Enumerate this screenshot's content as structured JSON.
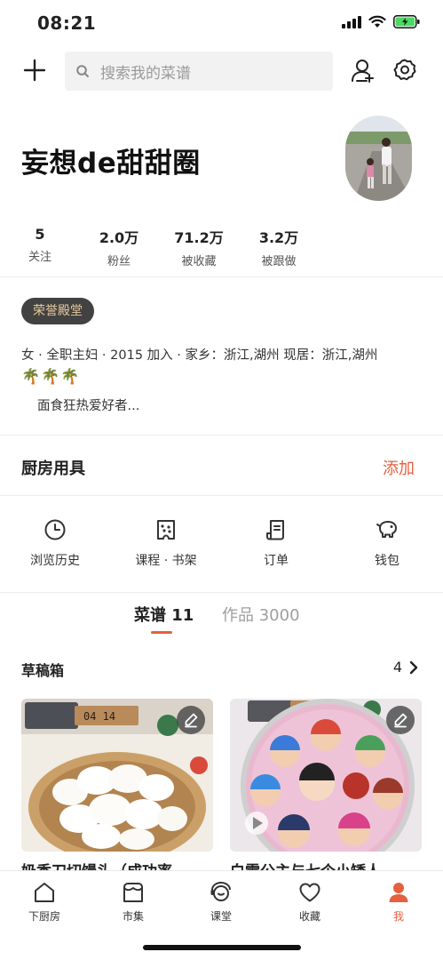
{
  "status_bar": {
    "time": "08:21"
  },
  "search": {
    "placeholder": "搜索我的菜谱"
  },
  "profile": {
    "name": "妄想de甜甜圈",
    "stats": [
      {
        "value": "5",
        "label": "关注"
      },
      {
        "value": "2.0万",
        "label": "粉丝"
      },
      {
        "value": "71.2万",
        "label": "被收藏"
      },
      {
        "value": "3.2万",
        "label": "被跟做"
      }
    ],
    "badge": "荣誉殿堂",
    "info": "女 · 全职主妇 · 2015 加入 · 家乡：浙江,湖州  现居：浙江,湖州",
    "palms": "🌴🌴🌴",
    "bio": "面食狂热爱好者..."
  },
  "kitchen": {
    "title": "厨房用具",
    "add_label": "添加"
  },
  "shortcuts": [
    {
      "label": "浏览历史",
      "icon": "clock-icon"
    },
    {
      "label": "课程 · 书架",
      "icon": "course-icon"
    },
    {
      "label": "订单",
      "icon": "receipt-icon"
    },
    {
      "label": "钱包",
      "icon": "piggy-bank-icon"
    }
  ],
  "tabs": [
    {
      "label": "菜谱 11",
      "active": true
    },
    {
      "label": "作品 3000",
      "active": false
    }
  ],
  "drafts": {
    "title": "草稿箱",
    "count": "4"
  },
  "cards": [
    {
      "title": "奶香刀切馒头（成功率"
    },
    {
      "title": "白雪公主与七个小矮人"
    }
  ],
  "tabbar": [
    {
      "label": "下厨房",
      "icon": "home-icon",
      "active": false
    },
    {
      "label": "市集",
      "icon": "shop-icon",
      "active": false
    },
    {
      "label": "课堂",
      "icon": "classroom-icon",
      "active": false
    },
    {
      "label": "收藏",
      "icon": "heart-icon",
      "active": false
    },
    {
      "label": "我",
      "icon": "person-icon",
      "active": true
    }
  ],
  "colors": {
    "accent": "#e4603f",
    "badge_bg": "#424242",
    "badge_text": "#e7c89a",
    "search_bg": "#f2f2f2"
  }
}
